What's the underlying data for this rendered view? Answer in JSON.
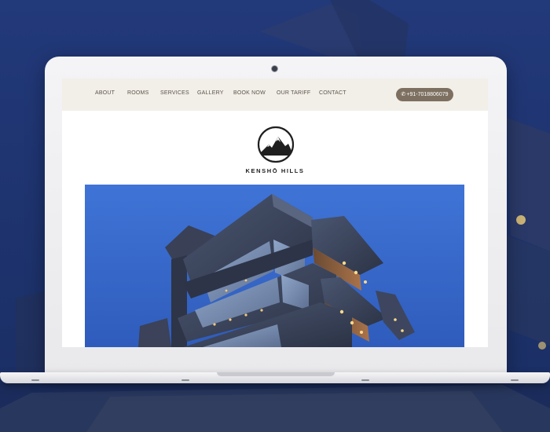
{
  "nav": {
    "items": [
      {
        "label": "ABOUT"
      },
      {
        "label": "ROOMS"
      },
      {
        "label": "SERVICES"
      },
      {
        "label": "GALLERY"
      },
      {
        "label": "BOOK NOW"
      },
      {
        "label": "OUR TARIFF"
      },
      {
        "label": "CONTACT"
      }
    ],
    "phone": "+91-7018806079",
    "phone_icon": "phone-icon"
  },
  "brand": {
    "name": "KENSHŌ HILLS",
    "logo_icon": "mountain-logo-icon"
  },
  "hero": {
    "subject": "building-photo"
  },
  "colors": {
    "background": "#1c336c",
    "nav_bg": "#f2efe9",
    "nav_text": "#5b5448",
    "phone_button": "#7d7060",
    "sky": "#3a6fd0"
  }
}
